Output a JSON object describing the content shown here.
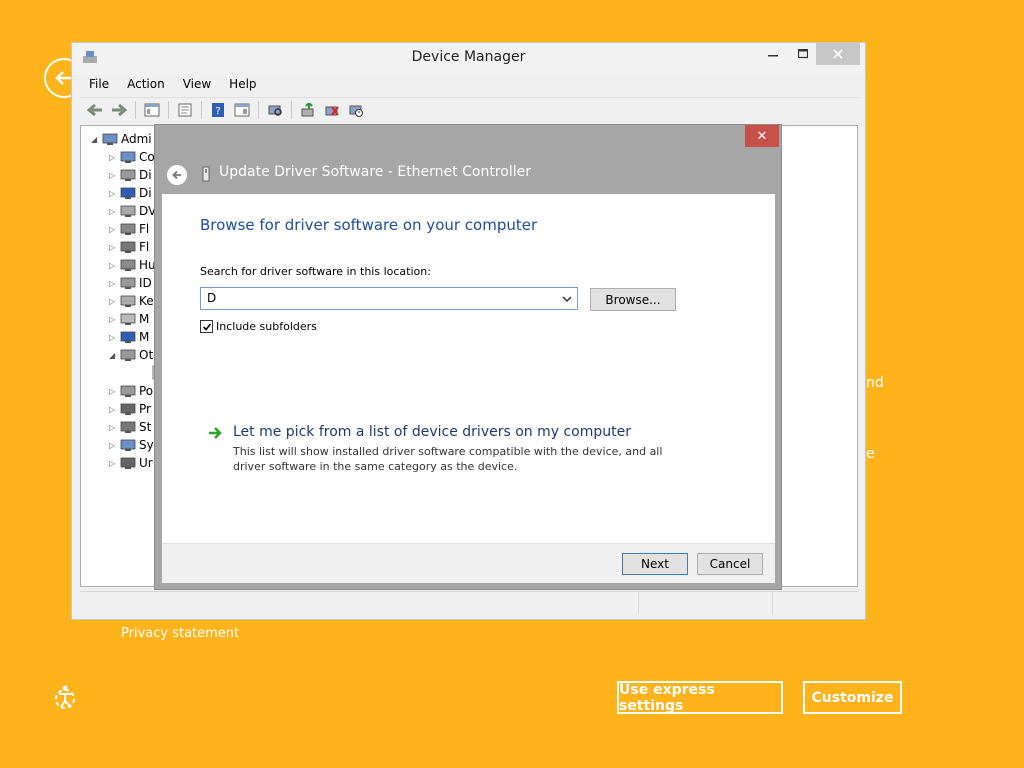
{
  "oobe": {
    "privacy_statement": "Privacy statement",
    "use_express_settings": "Use express settings",
    "customize": "Customize",
    "partial_text_1": "nd",
    "partial_text_2": "e"
  },
  "device_manager": {
    "title": "Device Manager",
    "menu": [
      "File",
      "Action",
      "View",
      "Help"
    ],
    "tree": [
      {
        "label": "Admi",
        "icon": "computer-icon",
        "expanded": true
      },
      {
        "label": "Co",
        "icon": "computer-icon"
      },
      {
        "label": "Di",
        "icon": "disk-drive-icon"
      },
      {
        "label": "Di",
        "icon": "display-adapter-icon"
      },
      {
        "label": "DV",
        "icon": "dvd-drive-icon"
      },
      {
        "label": "Fl",
        "icon": "floppy-icon"
      },
      {
        "label": "Fl",
        "icon": "floppy-drive-icon"
      },
      {
        "label": "Hu",
        "icon": "hid-icon"
      },
      {
        "label": "ID",
        "icon": "ide-controller-icon"
      },
      {
        "label": "Ke",
        "icon": "keyboard-icon"
      },
      {
        "label": "M",
        "icon": "mouse-icon"
      },
      {
        "label": "M",
        "icon": "monitor-icon"
      },
      {
        "label": "Ot",
        "icon": "other-devices-icon",
        "expanded": true
      },
      {
        "label": "",
        "icon": "unknown-device-warning-icon"
      },
      {
        "label": "Po",
        "icon": "port-icon"
      },
      {
        "label": "Pr",
        "icon": "processor-icon"
      },
      {
        "label": "St",
        "icon": "storage-controller-icon"
      },
      {
        "label": "Sy",
        "icon": "system-devices-icon"
      },
      {
        "label": "Ur",
        "icon": "usb-icon"
      }
    ]
  },
  "dialog": {
    "title": "Update Driver Software - Ethernet Controller",
    "heading": "Browse for driver software on your computer",
    "search_label": "Search for driver software in this location:",
    "search_value": "D",
    "browse_label": "Browse...",
    "include_subfolders_label": "Include subfolders",
    "include_subfolders_checked": true,
    "pick_title": "Let me pick from a list of device drivers on my computer",
    "pick_description": "This list will show installed driver software compatible with the device, and all driver software in the same category as the device.",
    "next_label": "Next",
    "cancel_label": "Cancel",
    "close_glyph": "✕"
  },
  "colors": {
    "background": "#ffb31a",
    "heading_blue": "#1b4ea0",
    "close_red": "#c7504b"
  }
}
